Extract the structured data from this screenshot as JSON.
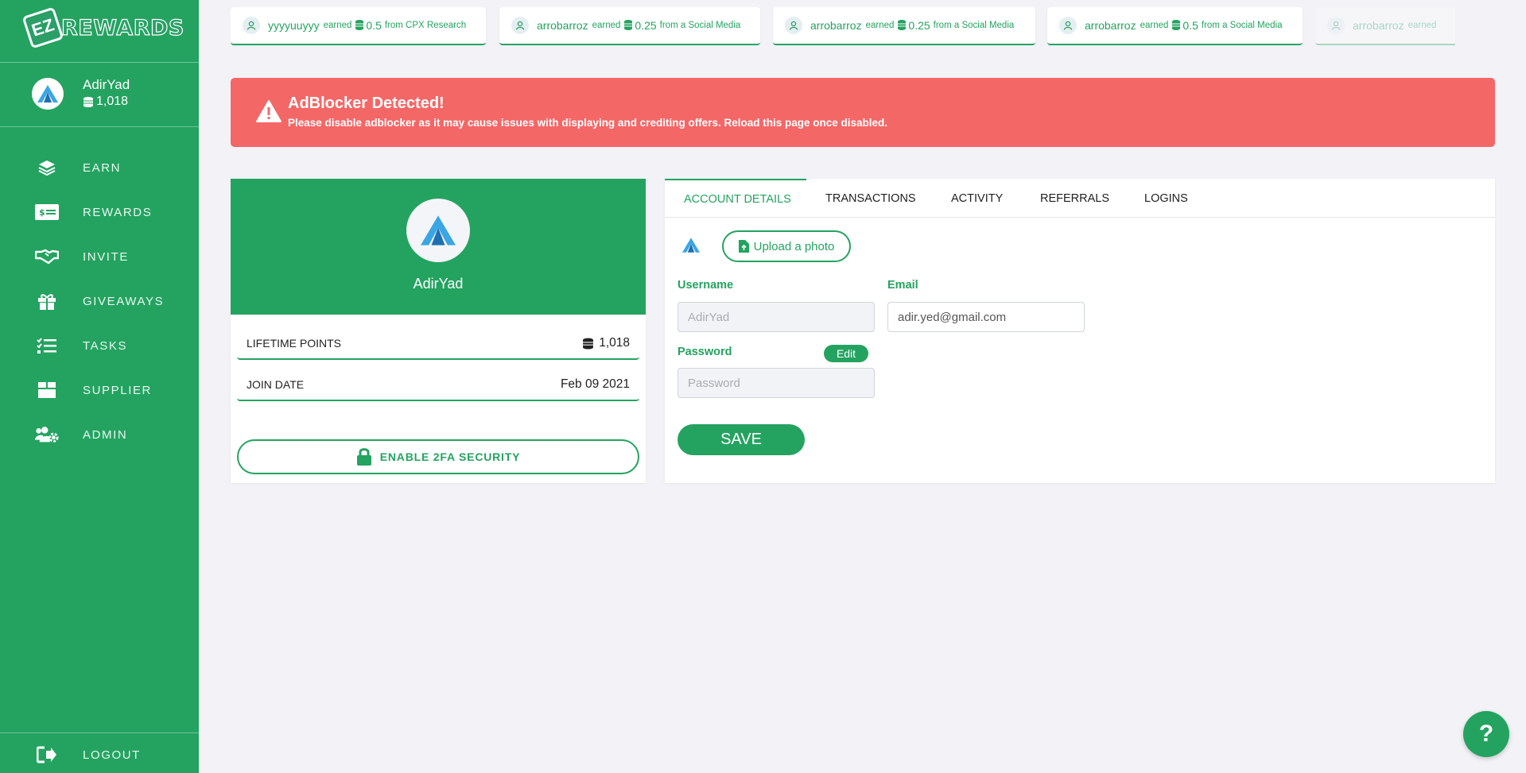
{
  "brand": {
    "logo_letters": "EZ",
    "logo_text": "REWARDS",
    "primary_color": "#24a360",
    "alert_color": "#f46767"
  },
  "user": {
    "name": "AdirYad",
    "points": "1,018"
  },
  "nav": [
    {
      "label": "EARN",
      "icon": "layers-icon"
    },
    {
      "label": "REWARDS",
      "icon": "money-bill-icon"
    },
    {
      "label": "INVITE",
      "icon": "handshake-icon"
    },
    {
      "label": "GIVEAWAYS",
      "icon": "gift-icon"
    },
    {
      "label": "TASKS",
      "icon": "tasks-icon"
    },
    {
      "label": "SUPPLIER",
      "icon": "box-icon"
    },
    {
      "label": "ADMIN",
      "icon": "users-cog-icon"
    }
  ],
  "logout_label": "LOGOUT",
  "ticker": [
    {
      "user": "yyyyuuyyy",
      "earned": "earned",
      "amount": "0.5",
      "source": "from CPX Research"
    },
    {
      "user": "arrobarroz",
      "earned": "earned",
      "amount": "0.25",
      "source": "from a Social Media"
    },
    {
      "user": "arrobarroz",
      "earned": "earned",
      "amount": "0.25",
      "source": "from a Social Media"
    },
    {
      "user": "arrobarroz",
      "earned": "earned",
      "amount": "0.5",
      "source": "from a Social Media"
    },
    {
      "user": "arrobarroz",
      "earned": "earned",
      "amount": "",
      "source": ""
    }
  ],
  "alert": {
    "title": "AdBlocker Detected!",
    "text": "Please disable adblocker as it may cause issues with displaying and crediting offers. Reload this page once disabled."
  },
  "profile": {
    "name": "AdirYad",
    "lifetime_label": "LIFETIME POINTS",
    "lifetime_value": "1,018",
    "join_label": "JOIN DATE",
    "join_value": "Feb 09 2021",
    "twofa_label": "ENABLE 2FA SECURITY"
  },
  "tabs": [
    "ACCOUNT DETAILS",
    "TRANSACTIONS",
    "ACTIVITY",
    "REFERRALS",
    "LOGINS"
  ],
  "account": {
    "upload_label": "Upload a photo",
    "username_label": "Username",
    "username_placeholder": "AdirYad",
    "email_label": "Email",
    "email_value": "adir.yed@gmail.com",
    "password_label": "Password",
    "password_placeholder": "Password",
    "edit_label": "Edit",
    "save_label": "SAVE"
  },
  "help_label": "?"
}
